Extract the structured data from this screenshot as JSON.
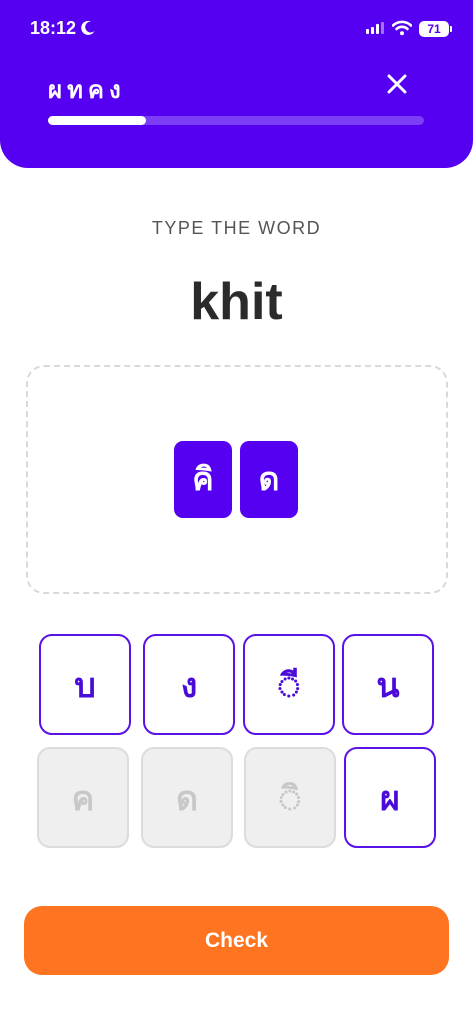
{
  "status_bar": {
    "time": "18:12",
    "battery": "71"
  },
  "header": {
    "lesson_title": "ผทคง",
    "progress": 0.26
  },
  "prompt": {
    "instruction": "TYPE THE WORD",
    "word": "khit"
  },
  "answer": {
    "tiles": [
      "คิ",
      "ด"
    ]
  },
  "letter_bank": {
    "rows": [
      [
        {
          "char": "บ",
          "used": false
        },
        {
          "char": "ง",
          "used": false
        },
        {
          "char": "◌ี",
          "used": false
        },
        {
          "char": "น",
          "used": false
        }
      ],
      [
        {
          "char": "ค",
          "used": true
        },
        {
          "char": "ด",
          "used": true
        },
        {
          "char": "◌ิ",
          "used": true
        },
        {
          "char": "ผ",
          "used": false
        }
      ]
    ]
  },
  "check_button": {
    "label": "Check"
  },
  "colors": {
    "primary": "#5500f0",
    "check": "#ff7420",
    "used_tile": "#efefef"
  }
}
